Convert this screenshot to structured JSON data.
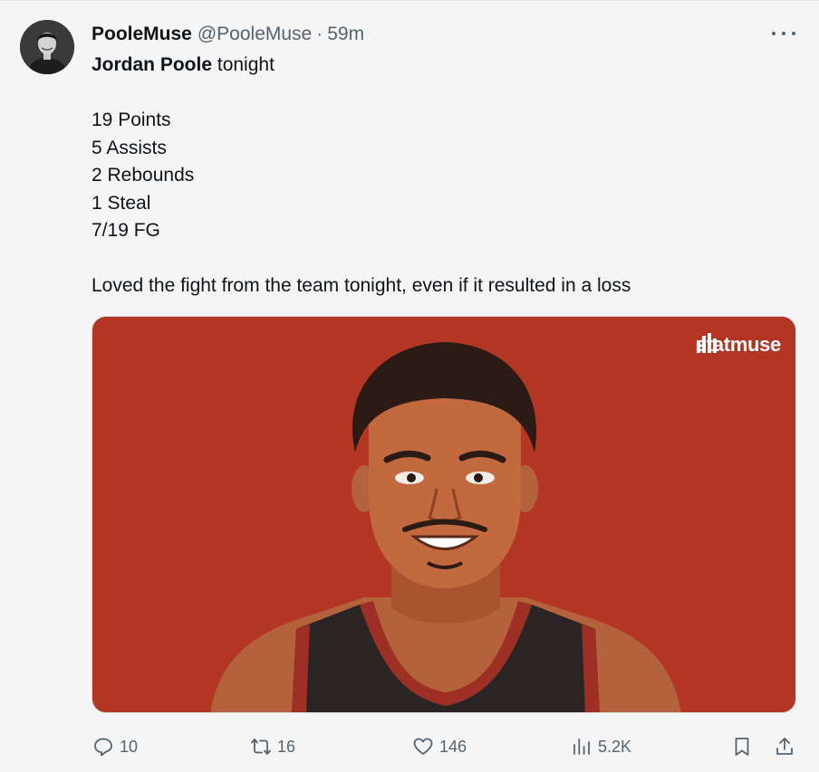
{
  "tweet": {
    "display_name": "PooleMuse",
    "handle": "@PooleMuse",
    "separator": "·",
    "time": "59m",
    "line1_bold": "Jordan Poole",
    "line1_rest": " tonight",
    "stats": [
      "19 Points",
      "5 Assists",
      "2 Rebounds",
      "1 Steal",
      "7/19 FG"
    ],
    "closing": "Loved the fight from the team tonight, even if it resulted in a loss"
  },
  "media": {
    "brand": "statmuse",
    "background_color": "#b33523"
  },
  "actions": {
    "replies": "10",
    "retweets": "16",
    "likes": "146",
    "views": "5.2K"
  }
}
